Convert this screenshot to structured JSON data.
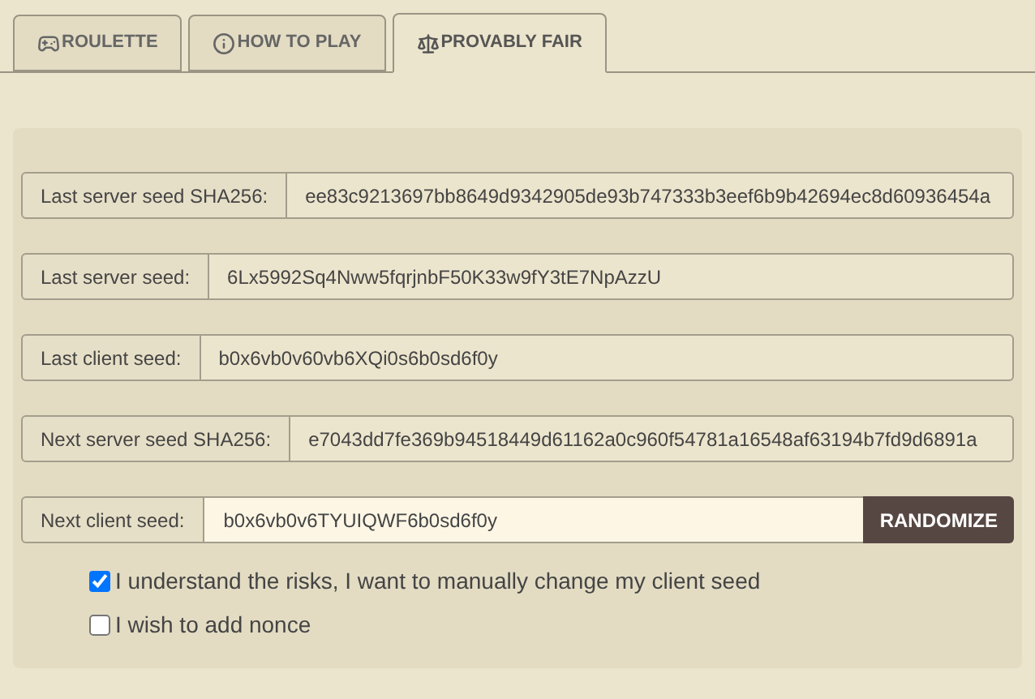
{
  "tabs": [
    {
      "label": "ROULETTE",
      "kind": "game",
      "selected": false
    },
    {
      "label": "HOW TO PLAY",
      "kind": "help",
      "selected": false
    },
    {
      "label": "PROVABLY FAIR",
      "kind": "fairness",
      "selected": true
    }
  ],
  "fields": [
    {
      "kind": "readonly",
      "label": "Last server seed SHA256:",
      "value": "ee83c9213697bb8649d9342905de93b747333b3eef6b9b42694ec8d60936454a"
    },
    {
      "kind": "readonly",
      "label": "Last server seed:",
      "value": "6Lx5992Sq4Nww5fqrjnbF50K33w9fY3tE7NpAzzU"
    },
    {
      "kind": "readonly",
      "label": "Last client seed:",
      "value": "b0x6vb0v60vb6XQi0s6b0sd6f0y"
    },
    {
      "kind": "readonly",
      "label": "Next server seed SHA256:",
      "value": "e7043dd7fe369b94518449d61162a0c960f54781a16548af63194b7fd9d6891a"
    },
    {
      "kind": "input",
      "label": "Next client seed:",
      "value": "b0x6vb0v6TYUIQWF6b0sd6f0y",
      "button": "RANDOMIZE"
    }
  ],
  "options": [
    {
      "label": "I understand the risks, I want to manually change my client seed",
      "checked": true
    },
    {
      "label": "I wish to add nonce",
      "checked": false
    }
  ]
}
